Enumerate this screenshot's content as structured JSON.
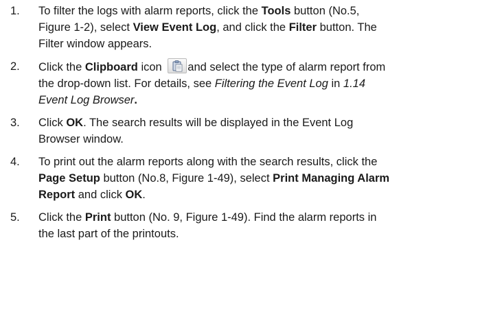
{
  "steps": [
    {
      "num": "1.",
      "l1a": "To filter the logs with alarm reports, click the ",
      "l1b": "Tools",
      "l1c": " button (No.5,",
      "l2a": "Figure 1-2), select ",
      "l2b": "View Event Log",
      "l2c": ", and click the ",
      "l2d": "Filter",
      "l2e": " button. The",
      "l3a": "Filter window appears."
    },
    {
      "num": "2.",
      "l1a": "Click the ",
      "l1b": "Clipboard",
      "l1c": " icon ",
      "l1d": "and select the type of alarm report from",
      "l2a": "the drop-down list. For details, see ",
      "l2b": "Filtering the Event Log",
      "l2c": " in ",
      "l2d": "1.14",
      "l3a": "Event Log Browser",
      "l3b": "."
    },
    {
      "num": "3.",
      "l1a": "Click ",
      "l1b": "OK",
      "l1c": ". The search results will be displayed in the Event Log",
      "l2a": "Browser window."
    },
    {
      "num": "4.",
      "l1a": "To print out the alarm reports along with the search results, click the",
      "l2a": "Page Setup",
      "l2b": " button (No.8, Figure 1-49), select ",
      "l2c": "Print Managing Alarm",
      "l3a": "Report",
      "l3b": " and click ",
      "l3c": "OK",
      "l3d": "."
    },
    {
      "num": "5.",
      "l1a": "Click the ",
      "l1b": "Print",
      "l1c": " button (No. 9, Figure 1-49). Find the alarm reports in",
      "l2a": "the last part of the printouts."
    }
  ],
  "icons": {
    "clipboard": "clipboard-icon"
  }
}
